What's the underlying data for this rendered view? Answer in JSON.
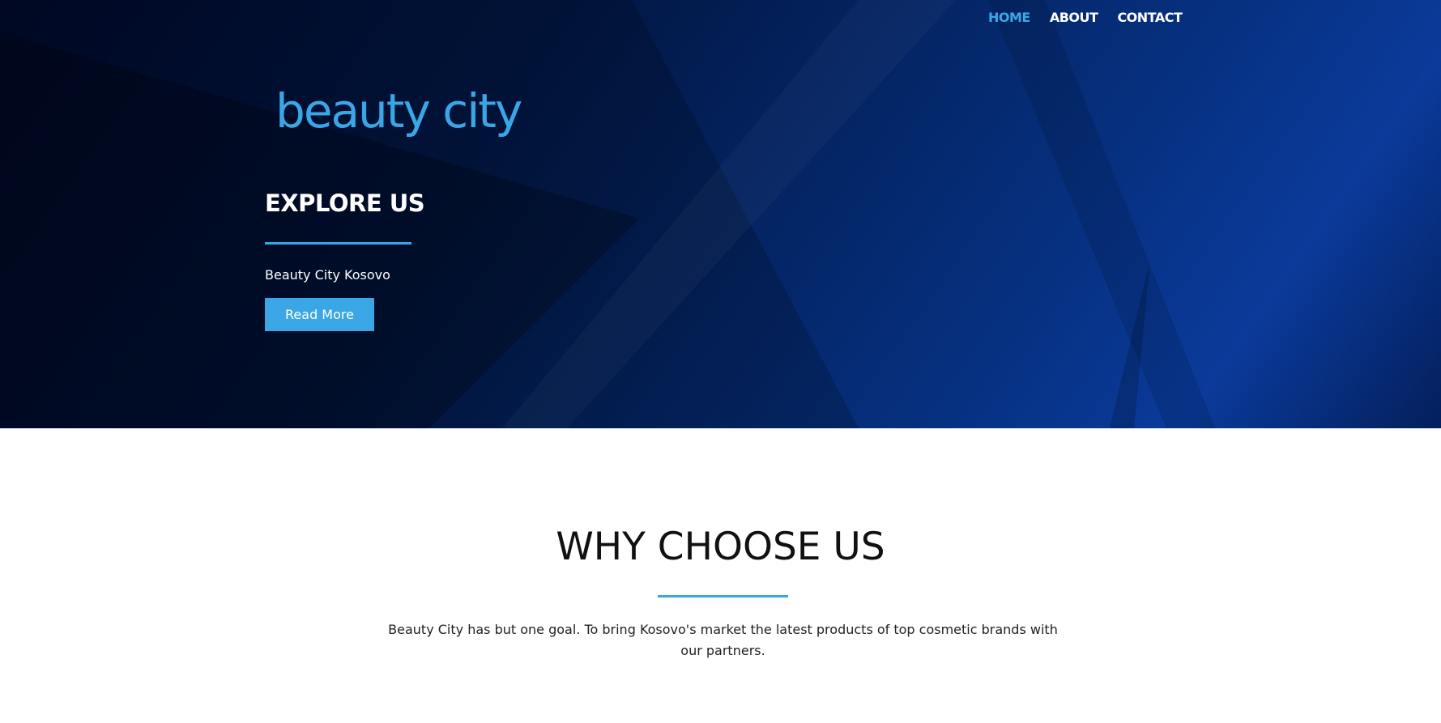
{
  "nav": {
    "items": [
      {
        "label": "HOME",
        "active": true
      },
      {
        "label": "ABOUT",
        "active": false
      },
      {
        "label": "CONTACT",
        "active": false
      }
    ]
  },
  "hero": {
    "logo_text": "beauty city",
    "title": "EXPLORE US",
    "subtitle": "Beauty City Kosovo",
    "button_label": "Read More"
  },
  "why": {
    "title": "WHY CHOOSE US",
    "text": "Beauty City has but one goal. To bring Kosovo's market the latest products of top cosmetic brands with our partners."
  },
  "colors": {
    "accent": "#3aa6e6",
    "hero_dark": "#000a2b",
    "hero_blue": "#0a3a9a"
  }
}
